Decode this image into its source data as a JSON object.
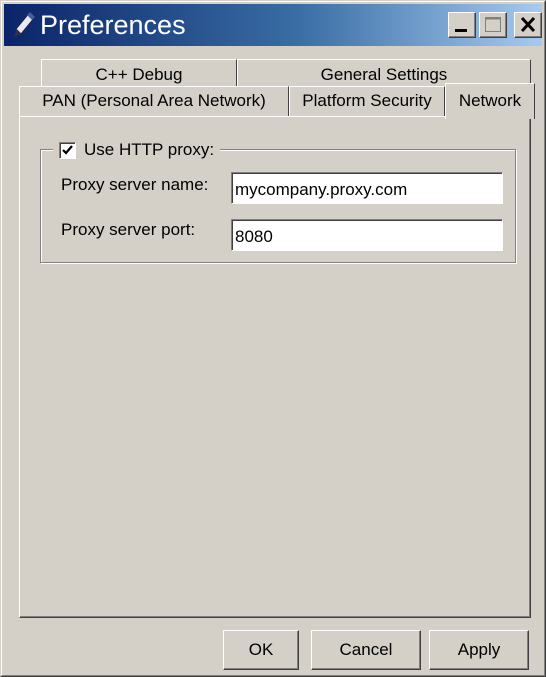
{
  "window": {
    "title": "Preferences",
    "icon": "pen-icon",
    "controls": {
      "minimize": "minimize-icon",
      "maximize": "maximize-icon",
      "close": "close-icon"
    }
  },
  "tabs": {
    "back_row": [
      {
        "label": "C++ Debug"
      },
      {
        "label": "General Settings"
      }
    ],
    "front_row": [
      {
        "label": "PAN (Personal Area Network)"
      },
      {
        "label": "Platform Security"
      },
      {
        "label": "Network",
        "selected": true
      }
    ]
  },
  "network": {
    "use_proxy_label": "Use HTTP proxy:",
    "use_proxy_checked": true,
    "server_name_label": "Proxy server name:",
    "server_name_value": "mycompany.proxy.com",
    "server_port_label": "Proxy server port:",
    "server_port_value": "8080"
  },
  "buttons": {
    "ok": "OK",
    "cancel": "Cancel",
    "apply": "Apply"
  },
  "colors": {
    "face": "#d4d0c8",
    "title_start": "#0a246a",
    "title_end": "#a6caf0"
  }
}
